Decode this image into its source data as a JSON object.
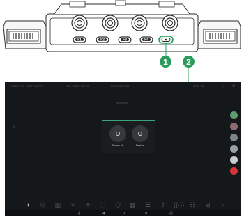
{
  "device": {
    "fkeys": [
      "F1",
      "F2",
      "F3",
      "F4"
    ]
  },
  "callouts": [
    "1",
    "2"
  ],
  "screen": {
    "status": {
      "input1": "HDMI FHD 1080P 60FPS",
      "input2": "FHD 1080P 60FPS",
      "center": "RECTION 0:00",
      "right": "23.11.06"
    },
    "timecode": "00:00:00",
    "side_label": "Tx",
    "popup": {
      "power_off": "Power off",
      "restart": "Restart"
    },
    "right_rail_colors": [
      "#5c9e6e",
      "#8c6a6f",
      "#7e8488",
      "#9aa0a4",
      "#c8cccf",
      "#d9343a"
    ],
    "toolbar_icons": [
      "contrast-icon",
      "color-icon",
      "histogram-icon",
      "focus-assist-icon",
      "crosshair-icon",
      "frame-guide-icon",
      "3d-lut-icon",
      "false-color-icon",
      "zebra-icon",
      "anamorphic-icon",
      "audio-icon",
      "waveform-icon",
      "grid-icon",
      "more-icon"
    ],
    "toolbar_glyphs": [
      "◑",
      "⚇",
      "▥",
      "✧",
      "＋",
      "⛶",
      "⬡",
      "▦",
      "☰",
      "⇕",
      "((·))",
      "☷",
      "⊞",
      "›"
    ],
    "navbar": [
      "◂)",
      "◀",
      "●",
      "■",
      "◂))"
    ]
  }
}
